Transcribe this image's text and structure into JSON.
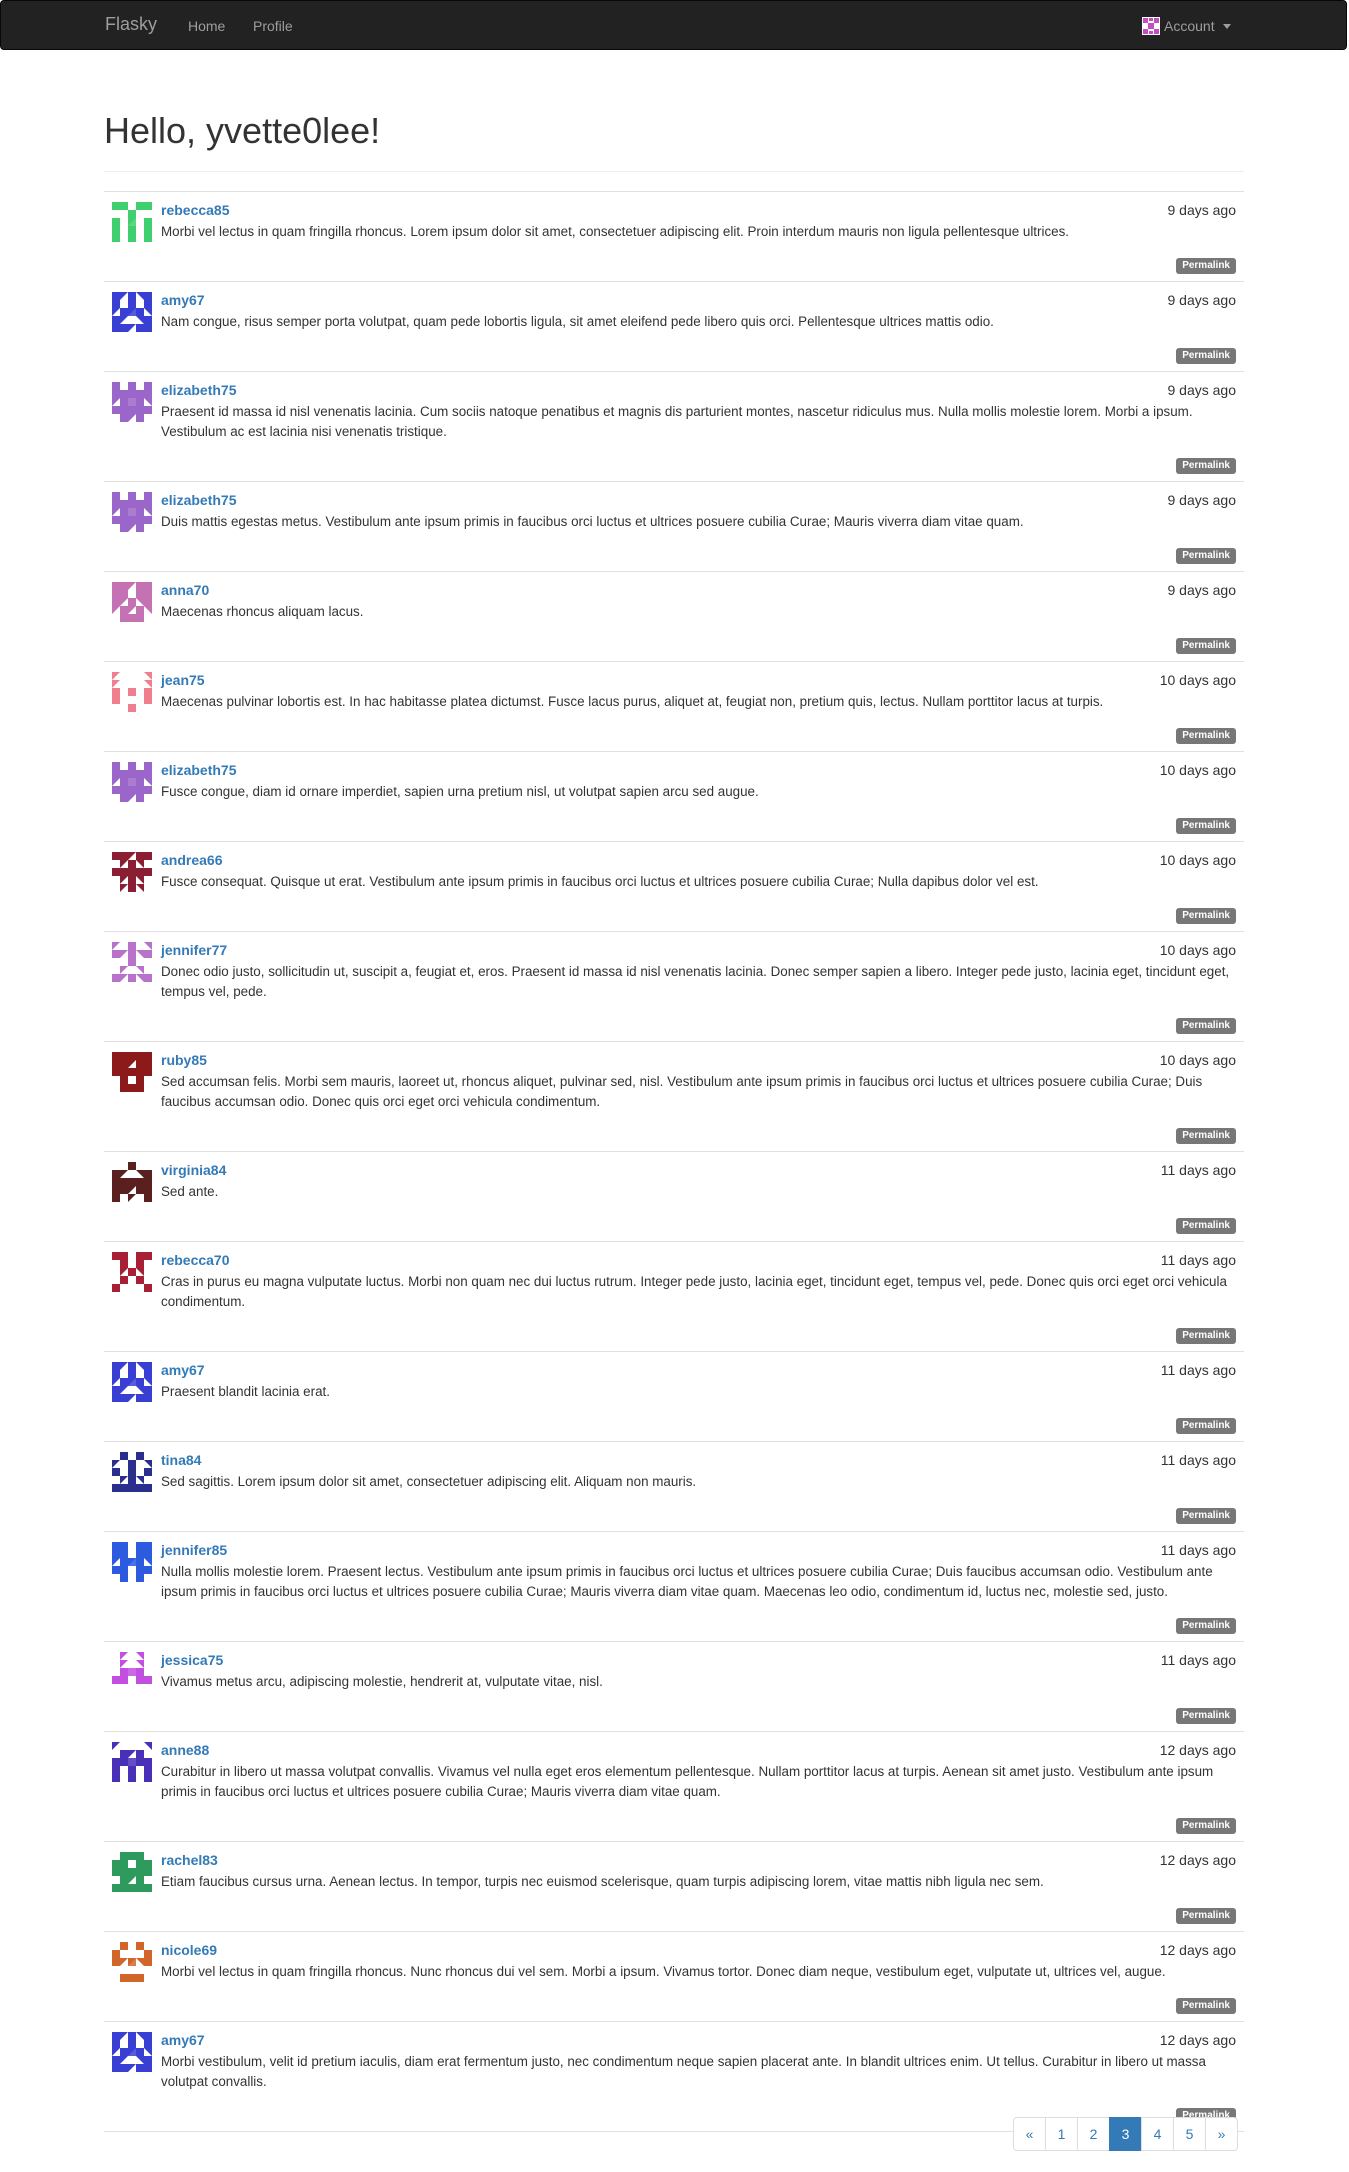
{
  "navbar": {
    "brand": "Flasky",
    "links": [
      "Home",
      "Profile"
    ],
    "account_label": "Account",
    "account_icon": "identicon-avatar-icon"
  },
  "header": {
    "title": "Hello, yvette0lee!"
  },
  "colors": {
    "link": "#337ab7",
    "navbar": "#222222",
    "label": "#777777",
    "active_page": "#337ab7"
  },
  "posts": [
    {
      "author": "rebecca85",
      "date": "9 days ago",
      "body": "Morbi vel lectus in quam fringilla rhoncus. Lorem ipsum dolor sit amet, consectetuer adipiscing elit. Proin interdum mauris non ligula pellentesque ultrices.",
      "permalink": "Permalink",
      "avatar_color": "#3fcf6e"
    },
    {
      "author": "amy67",
      "date": "9 days ago",
      "body": "Nam congue, risus semper porta volutpat, quam pede lobortis ligula, sit amet eleifend pede libero quis orci. Pellentesque ultrices mattis odio.",
      "permalink": "Permalink",
      "avatar_color": "#3a3fd4"
    },
    {
      "author": "elizabeth75",
      "date": "9 days ago",
      "body": "Praesent id massa id nisl venenatis lacinia. Cum sociis natoque penatibus et magnis dis parturient montes, nascetur ridiculus mus. Nulla mollis molestie lorem. Morbi a ipsum. Vestibulum ac est lacinia nisi venenatis tristique.",
      "permalink": "Permalink",
      "avatar_color": "#9b66c9"
    },
    {
      "author": "elizabeth75",
      "date": "9 days ago",
      "body": "Duis mattis egestas metus. Vestibulum ante ipsum primis in faucibus orci luctus et ultrices posuere cubilia Curae; Mauris viverra diam vitae quam.",
      "permalink": "Permalink",
      "avatar_color": "#9b66c9"
    },
    {
      "author": "anna70",
      "date": "9 days ago",
      "body": "Maecenas rhoncus aliquam lacus.",
      "permalink": "Permalink",
      "avatar_color": "#c472b4"
    },
    {
      "author": "jean75",
      "date": "10 days ago",
      "body": "Maecenas pulvinar lobortis est. In hac habitasse platea dictumst. Fusce lacus purus, aliquet at, feugiat non, pretium quis, lectus. Nullam porttitor lacus at turpis.",
      "permalink": "Permalink",
      "avatar_color": "#ef7f8e"
    },
    {
      "author": "elizabeth75",
      "date": "10 days ago",
      "body": "Fusce congue, diam id ornare imperdiet, sapien urna pretium nisl, ut volutpat sapien arcu sed augue.",
      "permalink": "Permalink",
      "avatar_color": "#9b66c9"
    },
    {
      "author": "andrea66",
      "date": "10 days ago",
      "body": "Fusce consequat. Quisque ut erat. Vestibulum ante ipsum primis in faucibus orci luctus et ultrices posuere cubilia Curae; Nulla dapibus dolor vel est.",
      "permalink": "Permalink",
      "avatar_color": "#8c1e33"
    },
    {
      "author": "jennifer77",
      "date": "10 days ago",
      "body": "Donec odio justo, sollicitudin ut, suscipit a, feugiat et, eros. Praesent id massa id nisl venenatis lacinia. Donec semper sapien a libero. Integer pede justo, lacinia eget, tincidunt eget, tempus vel, pede.",
      "permalink": "Permalink",
      "avatar_color": "#b872c9"
    },
    {
      "author": "ruby85",
      "date": "10 days ago",
      "body": "Sed accumsan felis. Morbi sem mauris, laoreet ut, rhoncus aliquet, pulvinar sed, nisl. Vestibulum ante ipsum primis in faucibus orci luctus et ultrices posuere cubilia Curae; Duis faucibus accumsan odio. Donec quis orci eget orci vehicula condimentum.",
      "permalink": "Permalink",
      "avatar_color": "#8c1a1a"
    },
    {
      "author": "virginia84",
      "date": "11 days ago",
      "body": "Sed ante.",
      "permalink": "Permalink",
      "avatar_color": "#5a2020"
    },
    {
      "author": "rebecca70",
      "date": "11 days ago",
      "body": "Cras in purus eu magna vulputate luctus. Morbi non quam nec dui luctus rutrum. Integer pede justo, lacinia eget, tincidunt eget, tempus vel, pede. Donec quis orci eget orci vehicula condimentum.",
      "permalink": "Permalink",
      "avatar_color": "#a82035"
    },
    {
      "author": "amy67",
      "date": "11 days ago",
      "body": "Praesent blandit lacinia erat.",
      "permalink": "Permalink",
      "avatar_color": "#3a3fd4"
    },
    {
      "author": "tina84",
      "date": "11 days ago",
      "body": "Sed sagittis. Lorem ipsum dolor sit amet, consectetuer adipiscing elit. Aliquam non mauris.",
      "permalink": "Permalink",
      "avatar_color": "#2a2e8c"
    },
    {
      "author": "jennifer85",
      "date": "11 days ago",
      "body": "Nulla mollis molestie lorem. Praesent lectus. Vestibulum ante ipsum primis in faucibus orci luctus et ultrices posuere cubilia Curae; Duis faucibus accumsan odio. Vestibulum ante ipsum primis in faucibus orci luctus et ultrices posuere cubilia Curae; Mauris viverra diam vitae quam. Maecenas leo odio, condimentum id, luctus nec, molestie sed, justo.",
      "permalink": "Permalink",
      "avatar_color": "#2d5be0"
    },
    {
      "author": "jessica75",
      "date": "11 days ago",
      "body": "Vivamus metus arcu, adipiscing molestie, hendrerit at, vulputate vitae, nisl.",
      "permalink": "Permalink",
      "avatar_color": "#c24fe0"
    },
    {
      "author": "anne88",
      "date": "12 days ago",
      "body": "Curabitur in libero ut massa volutpat convallis. Vivamus vel nulla eget eros elementum pellentesque. Nullam porttitor lacus at turpis. Aenean sit amet justo. Vestibulum ante ipsum primis in faucibus orci luctus et ultrices posuere cubilia Curae; Mauris viverra diam vitae quam.",
      "permalink": "Permalink",
      "avatar_color": "#4a2fb8"
    },
    {
      "author": "rachel83",
      "date": "12 days ago",
      "body": "Etiam faucibus cursus urna. Aenean lectus. In tempor, turpis nec euismod scelerisque, quam turpis adipiscing lorem, vitae mattis nibh ligula nec sem.",
      "permalink": "Permalink",
      "avatar_color": "#2f9a5e"
    },
    {
      "author": "nicole69",
      "date": "12 days ago",
      "body": "Morbi vel lectus in quam fringilla rhoncus. Nunc rhoncus dui vel sem. Morbi a ipsum. Vivamus tortor. Donec diam neque, vestibulum eget, vulputate ut, ultrices vel, augue.",
      "permalink": "Permalink",
      "avatar_color": "#d2662a"
    },
    {
      "author": "amy67",
      "date": "12 days ago",
      "body": "Morbi vestibulum, velit id pretium iaculis, diam erat fermentum justo, nec condimentum neque sapien placerat ante. In blandit ultrices enim. Ut tellus. Curabitur in libero ut massa volutpat convallis.",
      "permalink": "Permalink",
      "avatar_color": "#3a3fd4"
    }
  ],
  "pagination": {
    "prev": "«",
    "pages": [
      "1",
      "2",
      "3",
      "4",
      "5"
    ],
    "current": "3",
    "next": "»"
  }
}
